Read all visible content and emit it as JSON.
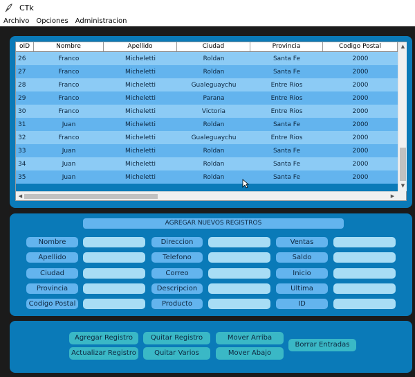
{
  "window": {
    "title": "CTk"
  },
  "menu": [
    "Archivo",
    "Opciones",
    "Administracion"
  ],
  "table": {
    "columns": [
      "oID",
      "Nombre",
      "Apellido",
      "Ciudad",
      "Provincia",
      "Codigo Postal"
    ],
    "rows": [
      [
        "26",
        "Franco",
        "Micheletti",
        "Roldan",
        "Santa Fe",
        "2000"
      ],
      [
        "27",
        "Franco",
        "Micheletti",
        "Roldan",
        "Santa Fe",
        "2000"
      ],
      [
        "28",
        "Franco",
        "Micheletti",
        "Gualeguaychu",
        "Entre Rios",
        "2000"
      ],
      [
        "29",
        "Franco",
        "Micheletti",
        "Parana",
        "Entre Rios",
        "2000"
      ],
      [
        "30",
        "Franco",
        "Micheletti",
        "Victoria",
        "Entre Rios",
        "2000"
      ],
      [
        "31",
        "Juan",
        "Micheletti",
        "Roldan",
        "Santa Fe",
        "2000"
      ],
      [
        "32",
        "Franco",
        "Micheletti",
        "Gualeguaychu",
        "Entre Rios",
        "2000"
      ],
      [
        "33",
        "Juan",
        "Micheletti",
        "Roldan",
        "Santa Fe",
        "2000"
      ],
      [
        "34",
        "Juan",
        "Micheletti",
        "Roldan",
        "Santa Fe",
        "2000"
      ],
      [
        "35",
        "Juan",
        "Micheletti",
        "Roldan",
        "Santa Fe",
        "2000"
      ]
    ]
  },
  "form": {
    "title": "AGREGAR NUEVOS REGISTROS",
    "col1": [
      "Nombre",
      "Apellido",
      "Ciudad",
      "Provincia",
      "Codigo Postal"
    ],
    "col2": [
      "Direccion",
      "Telefono",
      "Correo",
      "Descripcion",
      "Producto"
    ],
    "col3": [
      "Ventas",
      "Saldo",
      "Inicio",
      "Ultima",
      "ID"
    ]
  },
  "actions": {
    "agregar": "Agregar Registro",
    "quitar": "Quitar Registro",
    "mover_arriba": "Mover Arriba",
    "borrar": "Borrar Entradas",
    "actualizar": "Actualizar Registro",
    "quitar_varios": "Quitar Varios",
    "mover_abajo": "Mover Abajo"
  },
  "colors": {
    "panel": "#0a7ab8",
    "row_odd": "#63b4ee",
    "row_even": "#8ccbf5",
    "label": "#63b4ee",
    "field": "#a8ddf5",
    "button": "#3ab8c6"
  },
  "icons": {
    "app": "feather-icon",
    "cursor": "mouse-pointer-icon"
  }
}
